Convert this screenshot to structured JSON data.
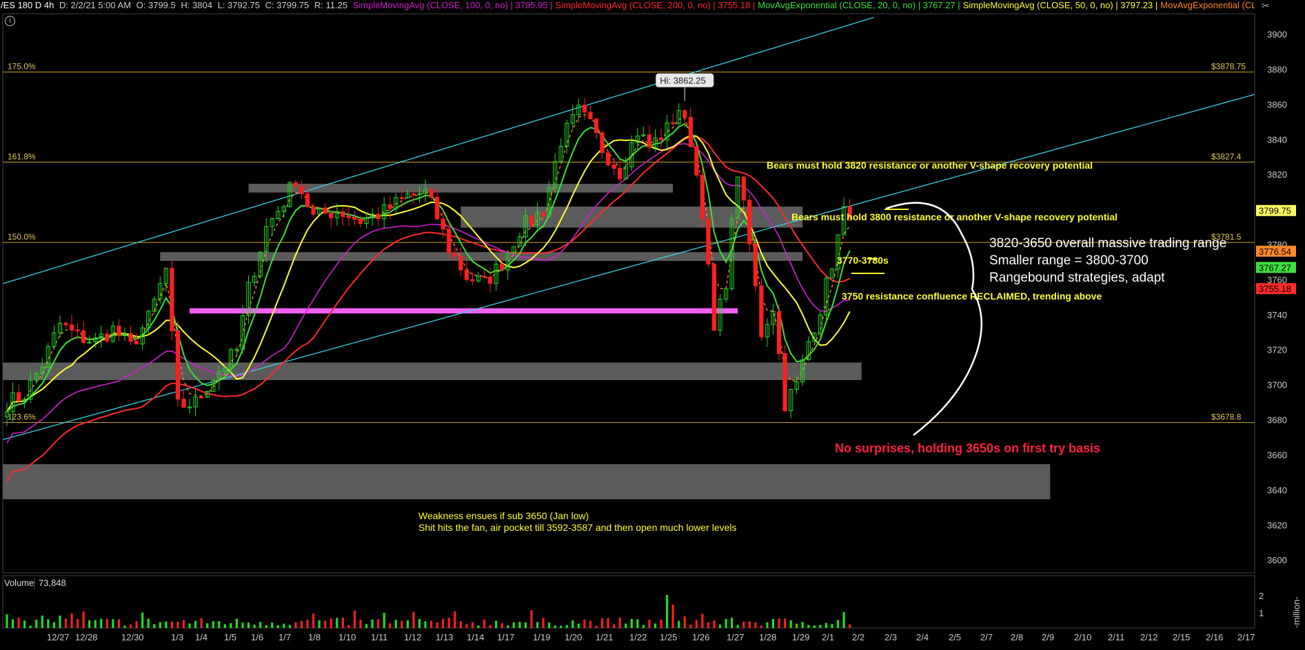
{
  "header": {
    "symbol": "/ES 180 D 4h",
    "date": "D: 2/2/21 5:00 AM",
    "open": "O: 3799.5",
    "high": "H: 3804",
    "low": "L: 3792.75",
    "close": "C: 3799.75",
    "range": "R: 11.25",
    "indicators": [
      {
        "label": "SimpleMovingAvg (CLOSE, 100, 0, no)",
        "value": "3795.95",
        "color": "#d21fd2"
      },
      {
        "label": "SimpleMovingAvg (CLOSE, 200, 0, no)",
        "value": "3755.18",
        "color": "#ff2a2a"
      },
      {
        "label": "MovAvgExponential (CLOSE, 20, 0, no)",
        "value": "3767.27",
        "color": "#3ee03e"
      },
      {
        "label": "SimpleMovingAvg (CLOSE, 50, 0, no)",
        "value": "3797.23",
        "color": "#ffff33"
      },
      {
        "label": "MovAvgExponential (CLOSE...",
        "value": "",
        "color": "#ff8a2a"
      }
    ]
  },
  "chart_data": {
    "type": "candlestick",
    "x_tick_labels": [
      "12/27",
      "12/28",
      "12/30",
      "1/3",
      "1/4",
      "1/5",
      "1/6",
      "1/7",
      "1/8",
      "1/10",
      "1/11",
      "1/12",
      "1/13",
      "1/14",
      "1/17",
      "1/19",
      "1/20",
      "1/21",
      "1/22",
      "1/25",
      "1/26",
      "1/27",
      "1/28",
      "1/29",
      "2/1",
      "2/2",
      "2/3",
      "2/4",
      "2/5",
      "2/7",
      "2/8",
      "2/9",
      "2/10",
      "2/11",
      "2/12",
      "2/15",
      "2/16",
      "2/17"
    ],
    "y_ticks": [
      3600,
      3620,
      3640,
      3660,
      3680,
      3700,
      3720,
      3740,
      3760,
      3780,
      3800,
      3820,
      3840,
      3860,
      3880,
      3900
    ],
    "ylim": [
      3593,
      3912
    ],
    "price_path": [
      [
        0,
        3690
      ],
      [
        3,
        3695
      ],
      [
        6,
        3712
      ],
      [
        9,
        3735
      ],
      [
        12,
        3728
      ],
      [
        15,
        3725
      ],
      [
        18,
        3732
      ],
      [
        21,
        3722
      ],
      [
        24,
        3738
      ],
      [
        27,
        3766
      ],
      [
        29,
        3688
      ],
      [
        32,
        3690
      ],
      [
        35,
        3705
      ],
      [
        37,
        3712
      ],
      [
        39,
        3720
      ],
      [
        41,
        3755
      ],
      [
        44,
        3790
      ],
      [
        47,
        3805
      ],
      [
        49,
        3818
      ],
      [
        52,
        3796
      ],
      [
        56,
        3800
      ],
      [
        60,
        3794
      ],
      [
        64,
        3799
      ],
      [
        68,
        3808
      ],
      [
        71,
        3810
      ],
      [
        73,
        3796
      ],
      [
        75,
        3778
      ],
      [
        78,
        3762
      ],
      [
        81,
        3758
      ],
      [
        84,
        3770
      ],
      [
        87,
        3789
      ],
      [
        91,
        3800
      ],
      [
        94,
        3840
      ],
      [
        97,
        3856
      ],
      [
        99,
        3848
      ],
      [
        101,
        3835
      ],
      [
        104,
        3822
      ],
      [
        107,
        3845
      ],
      [
        109,
        3836
      ],
      [
        112,
        3846
      ],
      [
        114,
        3858
      ],
      [
        116,
        3840
      ],
      [
        118,
        3800
      ],
      [
        120,
        3730
      ],
      [
        122,
        3760
      ],
      [
        124,
        3822
      ],
      [
        126,
        3780
      ],
      [
        128,
        3730
      ],
      [
        130,
        3745
      ],
      [
        132,
        3690
      ],
      [
        134,
        3700
      ],
      [
        136,
        3725
      ],
      [
        138,
        3744
      ],
      [
        140,
        3770
      ],
      [
        142,
        3798
      ],
      [
        143,
        3800
      ]
    ],
    "candle_count": 144,
    "fib_levels": [
      {
        "label": "175.0%",
        "price": 3878.75,
        "price_label": "$3878.75"
      },
      {
        "label": "161.8%",
        "price": 3827.4,
        "price_label": "$3827.4"
      },
      {
        "label": "150.0%",
        "price": 3781.5,
        "price_label": "$3781.5"
      },
      {
        "label": "123.6%",
        "price": 3678.8,
        "price_label": "$3678.8"
      }
    ],
    "zones": [
      {
        "from": 3810,
        "to": 3815,
        "start": 41,
        "end": 113
      },
      {
        "from": 3790,
        "to": 3802,
        "start": 77,
        "end": 135
      },
      {
        "from": 3771,
        "to": 3776,
        "start": 26,
        "end": 135
      },
      {
        "from": 3741,
        "to": 3744,
        "start": 31,
        "end": 124,
        "color": "#ff66ff"
      },
      {
        "from": 3703,
        "to": 3713,
        "start": 0,
        "end": 145
      },
      {
        "from": 3635,
        "to": 3655,
        "start": 0,
        "end": 177
      }
    ],
    "last_price": {
      "value": 3799.75,
      "label": "3799.75"
    },
    "price_tags": [
      {
        "value": 3776.54,
        "label": "3776.54",
        "color": "#ff8a2a"
      },
      {
        "value": 3767.27,
        "label": "3767.27",
        "color": "#3ee03e"
      },
      {
        "value": 3755.18,
        "label": "3755.18",
        "color": "#ff2a2a"
      }
    ],
    "high_marker": {
      "label": "Hi: 3862.25",
      "price": 3862.25,
      "index": 115
    },
    "volume": {
      "label": "Volume",
      "value": "73,848",
      "ticks": [
        "2",
        "1"
      ],
      "unit": "-million-"
    }
  },
  "annotations": {
    "bears_3820": "Bears must hold 3820 resistance or another V-shape recovery potential",
    "bears_3800": "Bears must hold 3800 resistance or another V-shape recovery potential",
    "range_3770": "3770-3780s",
    "resistance_3750": "3750 resistance confluence RECLAIMED, trending above",
    "overall_range": "3820-3650 overall massive trading range",
    "smaller_range": "Smaller range = 3800-3700",
    "rangebound": "Rangebound strategies, adapt",
    "no_surprises": "No surprises, holding 3650s on first try basis",
    "weakness_1": "Weakness ensues if sub 3650 (Jan low)",
    "weakness_2": "Shit hits the fan, air pocket till 3592-3587 and then open much lower levels"
  },
  "colors": {
    "up": "#22dd22",
    "down": "#ff1f1f",
    "zone": "#7a7a7a",
    "fib": "#d4a82a",
    "channel": "#3ccfe8"
  }
}
